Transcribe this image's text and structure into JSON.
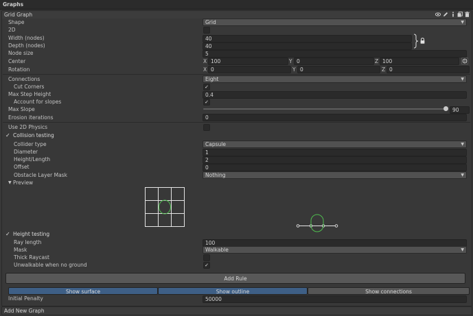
{
  "window": {
    "title": "Graphs"
  },
  "graph": {
    "title": "Grid Graph",
    "header_icons": [
      "eye-icon",
      "pencil-icon",
      "info-icon",
      "copy-icon",
      "trash-icon"
    ]
  },
  "props": {
    "shape": {
      "label": "Shape",
      "value": "Grid"
    },
    "twod": {
      "label": "2D",
      "checked": false
    },
    "width": {
      "label": "Width (nodes)",
      "value": "40"
    },
    "depth": {
      "label": "Depth (nodes)",
      "value": "40"
    },
    "node_size": {
      "label": "Node size",
      "value": "5"
    },
    "center": {
      "label": "Center",
      "x": "100",
      "y": "0",
      "z": "100"
    },
    "rotation": {
      "label": "Rotation",
      "x": "0",
      "y": "0",
      "z": "0"
    },
    "axis_x": "X",
    "axis_y": "Y",
    "axis_z": "Z"
  },
  "connections": {
    "connections": {
      "label": "Connections",
      "value": "Eight"
    },
    "cut_corners": {
      "label": "Cut Corners",
      "checked": true
    },
    "max_step_height": {
      "label": "Max Step Height",
      "value": "0.4"
    },
    "account_slopes": {
      "label": "Account for slopes",
      "checked": true
    },
    "max_slope": {
      "label": "Max Slope",
      "value": "90",
      "fraction": 1.0
    },
    "erosion": {
      "label": "Erosion iterations",
      "value": "0"
    }
  },
  "collision": {
    "use_2d_physics": {
      "label": "Use 2D Physics",
      "checked": false
    },
    "header": {
      "label": "Collision testing",
      "checked": true
    },
    "collider_type": {
      "label": "Collider type",
      "value": "Capsule"
    },
    "diameter": {
      "label": "Diameter",
      "value": "1"
    },
    "height_length": {
      "label": "Height/Length",
      "value": "2"
    },
    "offset": {
      "label": "Offset",
      "value": "0"
    },
    "obstacle_mask": {
      "label": "Obstacle Layer Mask",
      "value": "Nothing"
    },
    "preview": {
      "label": "Preview"
    }
  },
  "height_testing": {
    "header": {
      "label": "Height testing",
      "checked": true
    },
    "ray_length": {
      "label": "Ray length",
      "value": "100"
    },
    "mask": {
      "label": "Mask",
      "value": "Walkable"
    },
    "thick_raycast": {
      "label": "Thick Raycast",
      "checked": false
    },
    "unwalkable_no_ground": {
      "label": "Unwalkable when no ground",
      "checked": true
    }
  },
  "rules": {
    "add_rule": "Add Rule"
  },
  "show": {
    "surface": "Show surface",
    "outline": "Show outline",
    "connections": "Show connections"
  },
  "penalty": {
    "label": "Initial Penalty",
    "value": "50000"
  },
  "footer": {
    "add_new_graph": "Add New Graph"
  },
  "colors": {
    "accent_blue": "#3e5f86",
    "preview_green": "#4fbf4f",
    "panel": "#383838",
    "field": "#2a2a2a"
  }
}
